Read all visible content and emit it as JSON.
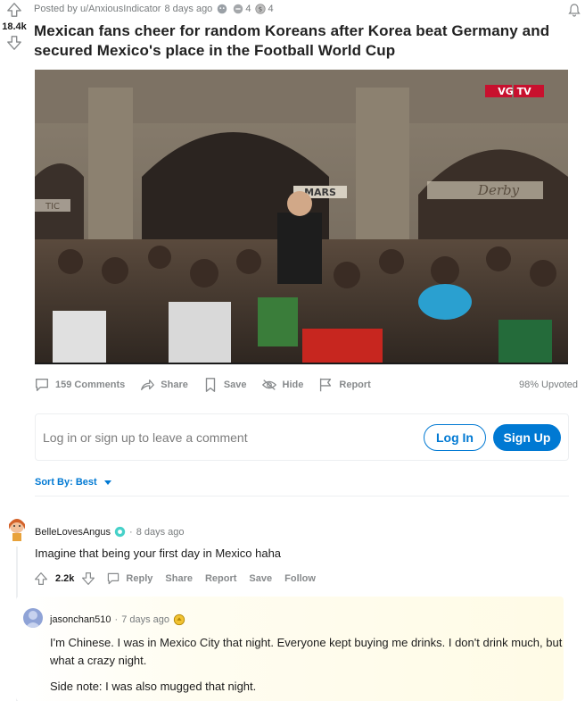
{
  "post": {
    "score": "18.4k",
    "posted_by": "Posted by u/AnxiousIndicator",
    "age": "8 days ago",
    "award_counts": [
      "4",
      "4"
    ],
    "title": "Mexican fans cheer for random Koreans after Korea beat Germany and secured Mexico's place in the Football World Cup",
    "media_overlay_texts": [
      "VG TV",
      "MARS",
      "Derby",
      "TIC"
    ]
  },
  "actions": {
    "comments": "159 Comments",
    "share": "Share",
    "save": "Save",
    "hide": "Hide",
    "report": "Report",
    "upvoted": "98% Upvoted"
  },
  "login": {
    "prompt": "Log in or sign up to leave a comment",
    "login_label": "Log In",
    "signup_label": "Sign Up"
  },
  "sort": {
    "label": "Sort By: Best"
  },
  "comments": [
    {
      "author": "BelleLovesAngus",
      "separator": "·",
      "age": "8 days ago",
      "body": "Imagine that being your first day in Mexico haha",
      "score": "2.2k",
      "actions": [
        "Reply",
        "Share",
        "Report",
        "Save",
        "Follow"
      ]
    },
    {
      "author": "jasonchan510",
      "separator": "·",
      "age": "7 days ago",
      "body": "I'm Chinese. I was in Mexico City that night. Everyone kept buying me drinks. I don't drink much, but what a crazy night.",
      "body2": "Side note: I was also mugged that night."
    }
  ],
  "colors": {
    "accent": "#0079d3",
    "muted": "#878a8c",
    "highlight": "#fffbe6"
  }
}
